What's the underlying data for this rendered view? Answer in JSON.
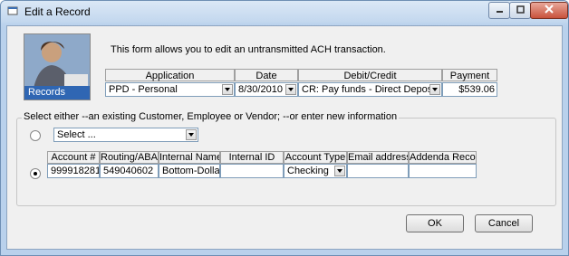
{
  "window": {
    "title": "Edit a Record"
  },
  "header": {
    "avatar_label": "Records",
    "intro_text": "This form allows you to edit an untransmitted ACH transaction."
  },
  "top_grid": {
    "columns": [
      "Application",
      "Date",
      "Debit/Credit",
      "Payment"
    ],
    "values": {
      "application": "PPD - Personal",
      "date": "8/30/2010",
      "debit_credit": "CR: Pay funds - Direct Deposit, Venc",
      "payment": "$539.06"
    }
  },
  "group": {
    "label": "Select either --an existing Customer, Employee or Vendor; --or enter new information",
    "select_placeholder": "Select ...",
    "radio_existing_checked": false,
    "radio_new_checked": true
  },
  "bottom_grid": {
    "columns": [
      "Account #",
      "Routing/ABA #",
      "Internal Name",
      "Internal ID",
      "Account Type",
      "Email address",
      "Addenda Record"
    ],
    "values": [
      "999918281",
      "549040602",
      "Bottom-Dollar Ma",
      "",
      "Checking",
      "",
      ""
    ]
  },
  "buttons": {
    "ok": "OK",
    "cancel": "Cancel"
  },
  "icons": {
    "window_icon": "app-window-icon",
    "minimize": "minimize-icon",
    "maximize": "maximize-icon",
    "close": "close-icon",
    "dropdown": "chevron-down-icon"
  }
}
